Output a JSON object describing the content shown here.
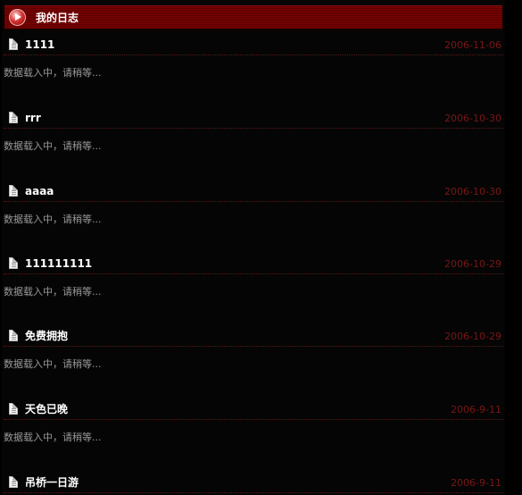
{
  "panel": {
    "title": "我的日志"
  },
  "entries": [
    {
      "title": "1111",
      "date": "2006-11-06",
      "body": "数据载入中，请稍等..."
    },
    {
      "title": "rrr",
      "date": "2006-10-30",
      "body": "数据载入中，请稍等..."
    },
    {
      "title": "aaaa",
      "date": "2006-10-30",
      "body": "数据载入中，请稍等..."
    },
    {
      "title": "111111111",
      "date": "2006-10-29",
      "body": "数据载入中，请稍等..."
    },
    {
      "title": "免费拥抱",
      "date": "2006-10-29",
      "body": "数据载入中，请稍等..."
    },
    {
      "title": "天色已晚",
      "date": "2006-9-11",
      "body": "数据载入中，请稍等..."
    },
    {
      "title": "吊桥一日游",
      "date": "2006-9-11",
      "body": ""
    }
  ]
}
